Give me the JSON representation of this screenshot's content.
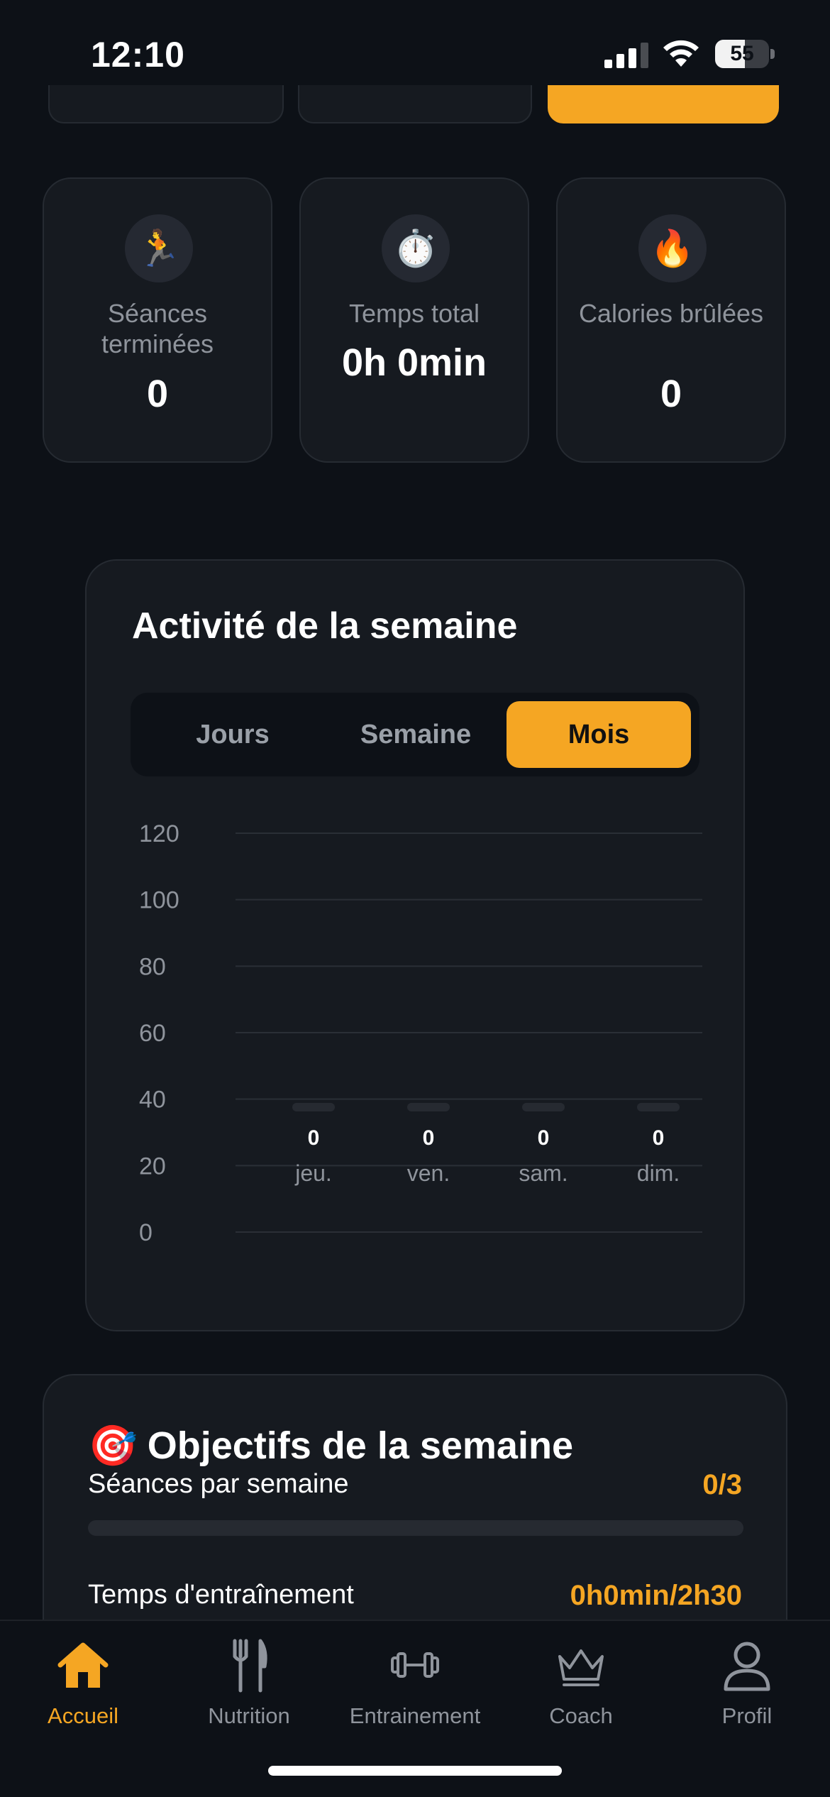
{
  "status_bar": {
    "time": "12:10",
    "battery": "55",
    "battery_level": 0.55
  },
  "stats": [
    {
      "icon": "runner-icon",
      "emoji": "🏃",
      "label": "Séances terminées",
      "value": "0"
    },
    {
      "icon": "stopwatch-icon",
      "emoji": "⏱️",
      "label": "Temps total",
      "value": "0h 0min"
    },
    {
      "icon": "fire-icon",
      "emoji": "🔥",
      "label": "Calories brûlées",
      "value": "0"
    }
  ],
  "activity": {
    "title": "Activité de la semaine",
    "tabs": [
      "Jours",
      "Semaine",
      "Mois"
    ],
    "selected_tab": "Mois"
  },
  "chart_data": {
    "type": "bar",
    "categories": [
      "jeu.",
      "ven.",
      "sam.",
      "dim."
    ],
    "values": [
      0,
      0,
      0,
      0
    ],
    "value_labels": [
      "0",
      "0",
      "0",
      "0"
    ],
    "ylim": [
      0,
      120
    ],
    "yticks": [
      "0",
      "20",
      "40",
      "60",
      "80",
      "100",
      "120"
    ],
    "grid": true
  },
  "goals": {
    "emoji": "🎯",
    "title": "Objectifs de la semaine",
    "sessions_label": "Séances par semaine",
    "sessions_value": "0/3",
    "sessions_progress": 0,
    "time_label": "Temps d'entraînement",
    "time_value": "0h0min/2h30"
  },
  "tab_bar": {
    "items": [
      {
        "label": "Accueil",
        "icon": "home-icon",
        "active": true
      },
      {
        "label": "Nutrition",
        "icon": "fork-knife-icon",
        "active": false
      },
      {
        "label": "Entrainement",
        "icon": "dumbbell-icon",
        "active": false
      },
      {
        "label": "Coach",
        "icon": "crown-icon",
        "active": false
      },
      {
        "label": "Profil",
        "icon": "person-icon",
        "active": false
      }
    ]
  },
  "colors": {
    "accent": "#f5a623",
    "background": "#0d1117",
    "card": "#161a20",
    "muted": "#8f949c"
  }
}
